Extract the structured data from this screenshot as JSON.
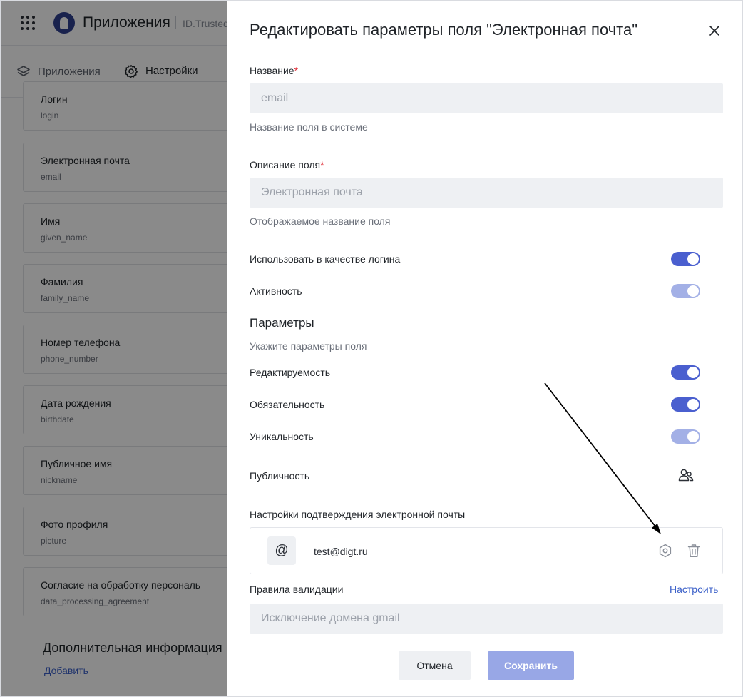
{
  "app": {
    "title": "Приложения",
    "subtitle": "ID.Trusted"
  },
  "nav_tabs": [
    {
      "label": "Приложения",
      "icon": "layers-icon"
    },
    {
      "label": "Настройки",
      "icon": "gear-icon",
      "active": true
    }
  ],
  "fields": [
    {
      "title": "Логин",
      "key": "login"
    },
    {
      "title": "Электронная почта",
      "key": "email"
    },
    {
      "title": "Имя",
      "key": "given_name"
    },
    {
      "title": "Фамилия",
      "key": "family_name"
    },
    {
      "title": "Номер телефона",
      "key": "phone_number"
    },
    {
      "title": "Дата рождения",
      "key": "birthdate"
    },
    {
      "title": "Публичное имя",
      "key": "nickname"
    },
    {
      "title": "Фото профиля",
      "key": "picture"
    },
    {
      "title": "Согласие на обработку персональ",
      "key": "data_processing_agreement"
    }
  ],
  "extra": {
    "title": "Дополнительная информация",
    "add_label": "Добавить"
  },
  "modal": {
    "title": "Редактировать параметры поля \"Электронная почта\"",
    "name_label": "Название",
    "required_mark": "*",
    "name_placeholder": "email",
    "name_hint": "Название поля в системе",
    "desc_label": "Описание поля",
    "desc_placeholder": "Электронная почта",
    "desc_hint": "Отображаемое название поля",
    "toggles_main": [
      {
        "label": "Использовать в качестве логина",
        "on": true,
        "disabled": false
      },
      {
        "label": "Активность",
        "on": true,
        "disabled": true
      }
    ],
    "params_title": "Параметры",
    "params_sub": "Укажите параметры поля",
    "toggles_params": [
      {
        "label": "Редактируемость",
        "on": true,
        "disabled": false
      },
      {
        "label": "Обязательность",
        "on": true,
        "disabled": false
      },
      {
        "label": "Уникальность",
        "on": true,
        "disabled": true
      }
    ],
    "publicity_label": "Публичность",
    "email_confirm_label": "Настройки подтверждения электронной почты",
    "email_provider": {
      "icon_glyph": "@",
      "email": "test@digt.ru"
    },
    "validation_label": "Правила валидации",
    "configure_link": "Настроить",
    "validation_placeholder": "Исключение домена gmail",
    "cancel_label": "Отмена",
    "save_label": "Сохранить"
  },
  "colors": {
    "accent": "#4a5fcf",
    "accent_disabled": "#a3b0e6",
    "link": "#3a5fc8",
    "required": "#e0313a",
    "overlay": "rgba(0,0,0,0.46)"
  }
}
